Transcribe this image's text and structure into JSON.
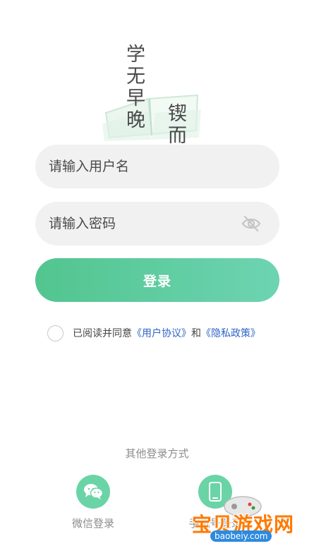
{
  "hero": {
    "left_line": "学无早晚",
    "right_line": "锲而不舍"
  },
  "form": {
    "username_placeholder": "请输入用户名",
    "password_placeholder": "请输入密码",
    "login_label": "登录"
  },
  "agreement": {
    "prefix": "已阅读并同意",
    "user_agreement": "《用户协议》",
    "and": "和",
    "privacy_policy": "《隐私政策》"
  },
  "other_login": {
    "title": "其他登录方式",
    "methods": [
      {
        "label": "微信登录",
        "icon": "wechat-icon"
      },
      {
        "label": "手机号登录",
        "icon": "phone-icon"
      }
    ]
  },
  "watermark": {
    "title": "宝贝游戏网",
    "url": "baobeiy.com"
  },
  "colors": {
    "accent": "#5ccb9e",
    "link": "#2e64c8",
    "field_bg": "#f1f1f1"
  }
}
